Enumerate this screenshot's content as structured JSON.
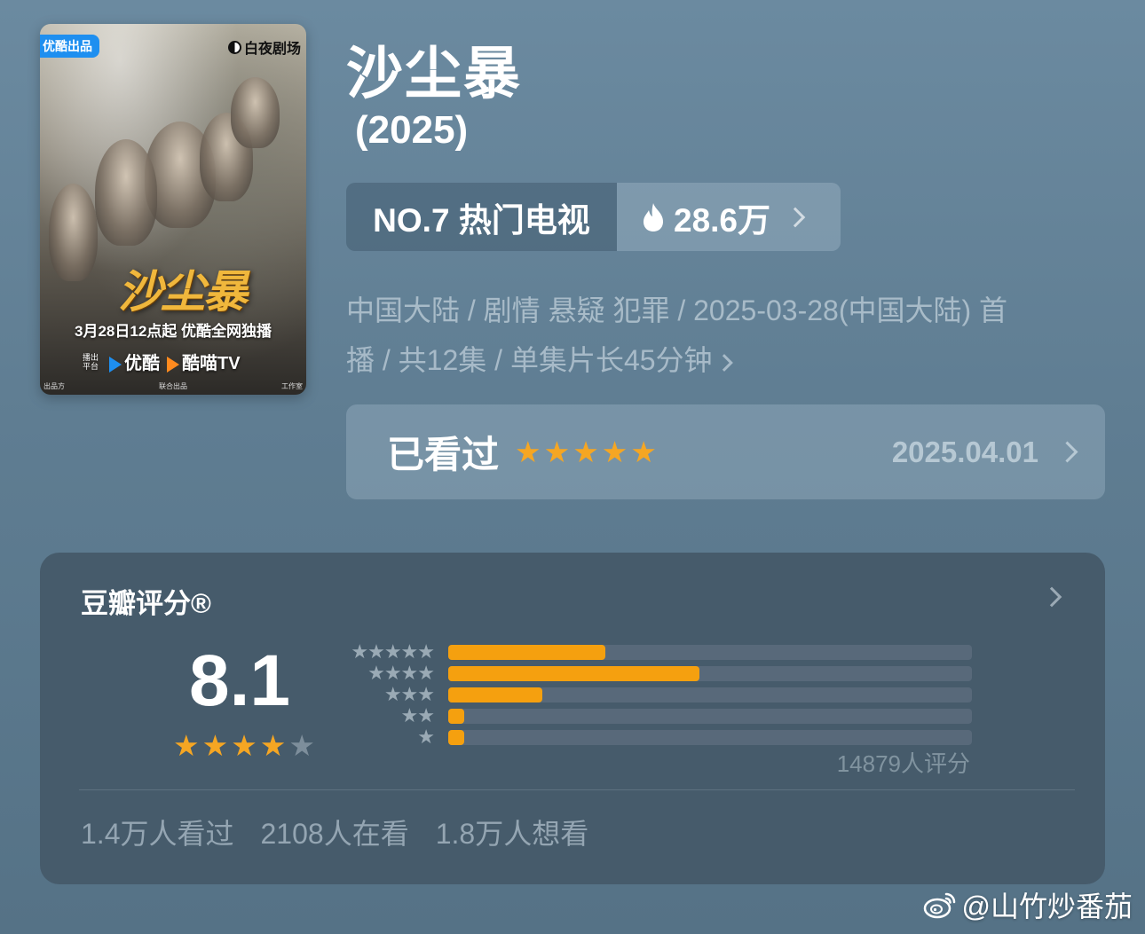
{
  "poster": {
    "badge": "优酷出品",
    "logo": "白夜剧场",
    "title_art": "沙尘暴",
    "tagline": "3月28日12点起 优酷全网独播",
    "platform_label": "播出平台",
    "platform_1": "优酷",
    "platform_2": "酷喵TV",
    "credit_left": "出品方",
    "credit_mid": "联合出品",
    "credit_right": "工作室"
  },
  "show": {
    "title": "沙尘暴",
    "year": "(2025)",
    "rank": "NO.7 热门电视",
    "heat": "28.6万",
    "meta_line1": "中国大陆 / 剧情 悬疑 犯罪 / 2025-03-28(中国大陆) 首",
    "meta_line2": "播 / 共12集 / 单集片长45分钟"
  },
  "watched": {
    "label": "已看过",
    "stars": 5,
    "date": "2025.04.01"
  },
  "douban": {
    "title": "豆瓣评分®",
    "score": "8.1",
    "score_stars": 4,
    "distribution_percent": [
      30,
      48,
      18,
      3,
      3
    ],
    "rating_count": "14879人评分",
    "stats": [
      "1.4万人看过",
      "2108人在看",
      "1.8万人想看"
    ]
  },
  "watermark": {
    "text": "@山竹炒番茄"
  },
  "colors": {
    "accent_star": "#f5a623",
    "bar_fill": "#f5a00f",
    "card_bg": "#465b6b"
  },
  "icons": {
    "heat": "flame-icon",
    "more": "chevron-right-icon",
    "watermark": "weibo-icon"
  }
}
